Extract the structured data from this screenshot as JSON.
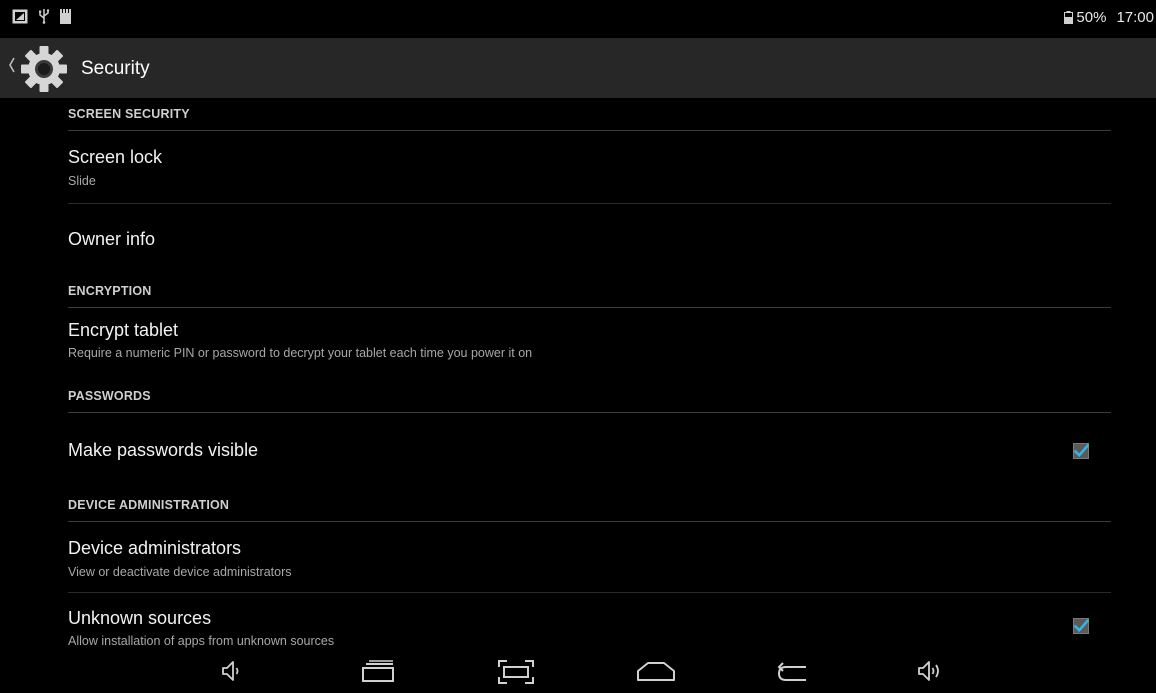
{
  "status_bar": {
    "icons": [
      "screenshot-notification-icon",
      "usb-icon",
      "sd-card-icon"
    ],
    "battery_icon": "battery-icon",
    "battery_level": "50%",
    "time": "17:00"
  },
  "action_bar": {
    "title": "Security",
    "app_icon": "gear-icon",
    "up_icon": "chevron-left-icon"
  },
  "sections": {
    "screen_security": "SCREEN SECURITY",
    "encryption": "ENCRYPTION",
    "passwords": "PASSWORDS",
    "device_administration": "DEVICE ADMINISTRATION"
  },
  "prefs": {
    "screen_lock": {
      "title": "Screen lock",
      "summary": "Slide"
    },
    "owner_info": {
      "title": "Owner info"
    },
    "encrypt_tablet": {
      "title": "Encrypt tablet",
      "summary": "Require a numeric PIN or password to decrypt your tablet each time you power it on"
    },
    "make_passwords_visible": {
      "title": "Make passwords visible",
      "checked": true
    },
    "device_administrators": {
      "title": "Device administrators",
      "summary": "View or deactivate device administrators"
    },
    "unknown_sources": {
      "title": "Unknown sources",
      "summary": "Allow installation of apps from unknown sources",
      "checked": true
    }
  },
  "nav_bar": {
    "icons": [
      "volume-down-icon",
      "recent-apps-icon",
      "screenshot-icon",
      "home-icon",
      "back-icon",
      "volume-up-icon"
    ]
  },
  "colors": {
    "background": "#000000",
    "action_bar": "#272727",
    "checkbox_accent": "#33b5e5",
    "section_text": "#cfcfcf",
    "summary_text": "#a8a8a8"
  }
}
